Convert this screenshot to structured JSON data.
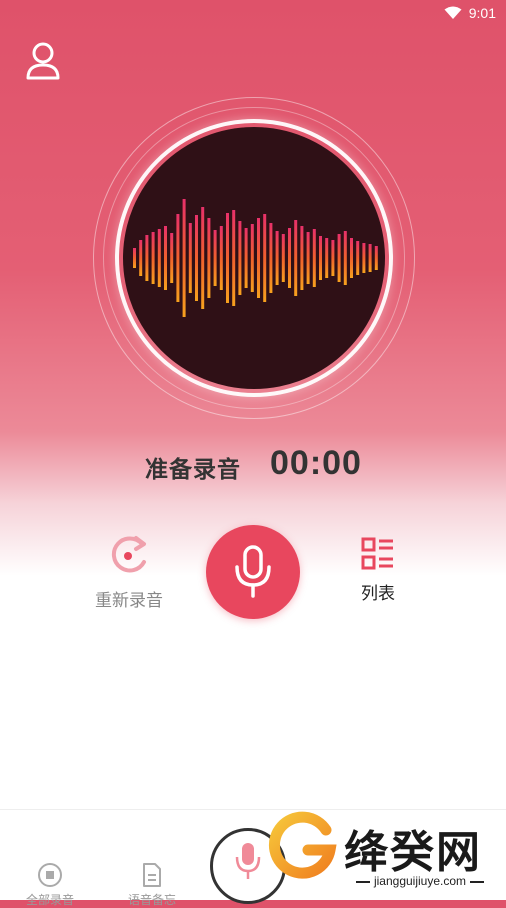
{
  "status_bar": {
    "time": "9:01",
    "wifi_icon": "wifi-icon"
  },
  "header": {
    "profile_icon": "user-icon"
  },
  "recorder": {
    "status": "准备录音",
    "timer": "00:00",
    "visualizer_icon": "waveform-icon",
    "rerecord_label": "重新录音",
    "list_label": "列表",
    "record_icon": "microphone-icon"
  },
  "bottom_nav": {
    "items": [
      {
        "label": "全部录音",
        "icon": "stop-circle-icon"
      },
      {
        "label": "语音备忘",
        "icon": "file-note-icon"
      }
    ],
    "center_icon": "microphone-icon"
  },
  "watermark": {
    "text": "绛癸网",
    "url": "jiangguijiuye.com"
  },
  "colors": {
    "accent": "#e8475e",
    "gradient_top": "#df526a",
    "disc": "#2f1016",
    "wave_top": "#e8306a",
    "wave_bottom": "#f7a21e"
  }
}
